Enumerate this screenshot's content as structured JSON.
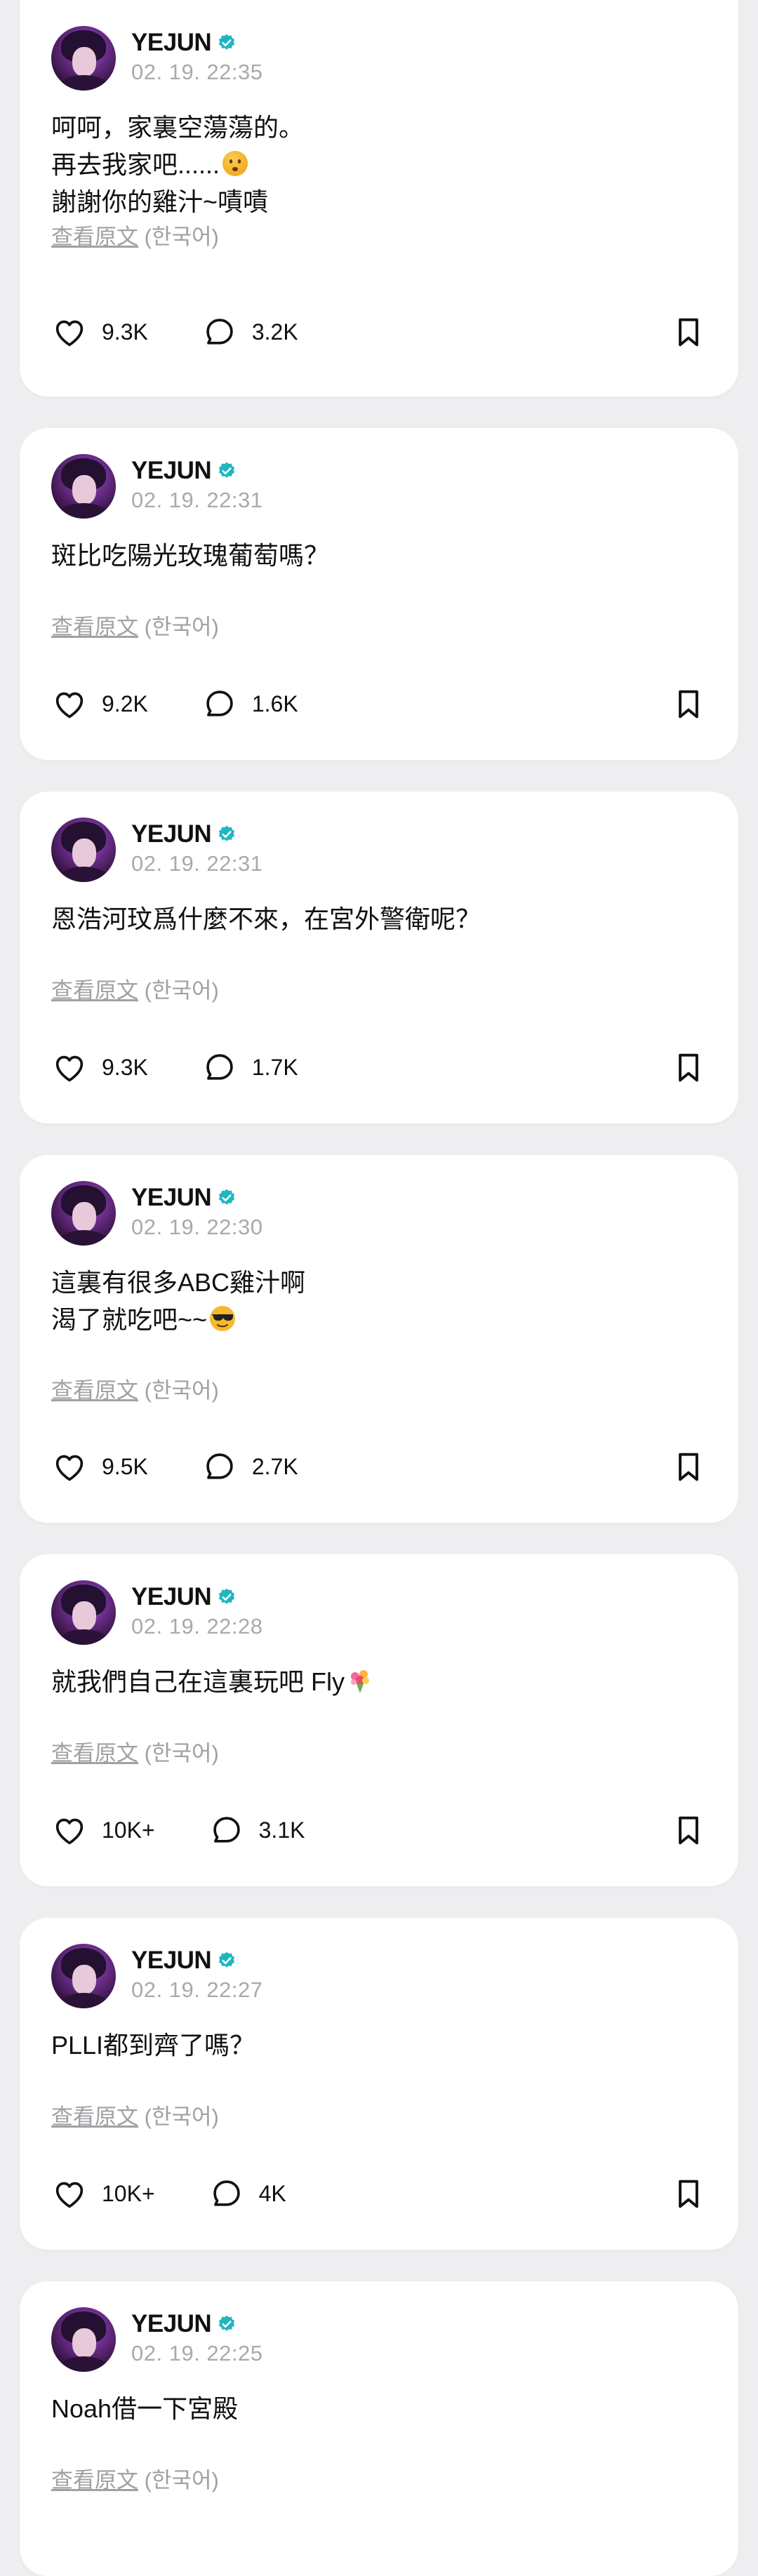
{
  "translate": {
    "link_label": "查看原文",
    "lang_label": "(한국어)"
  },
  "colors": {
    "verified_badge": "#1fb6c1",
    "timestamp": "#a9a9ae",
    "background": "#eeeef0"
  },
  "icons": {
    "like": "heart-icon",
    "comment": "comment-bubble-icon",
    "save": "bookmark-icon",
    "verified": "verified-badge-icon"
  },
  "posts": [
    {
      "author": "YEJUN",
      "time": "02. 19. 22:35",
      "lines": [
        "呵呵，家裏空蕩蕩的。",
        "再去我家吧......",
        "謝謝你的雞汁~嘖嘖"
      ],
      "likes": "9.3K",
      "comments": "3.2K"
    },
    {
      "author": "YEJUN",
      "time": "02. 19. 22:31",
      "lines": [
        "斑比吃陽光玫瑰葡萄嗎？"
      ],
      "likes": "9.2K",
      "comments": "1.6K"
    },
    {
      "author": "YEJUN",
      "time": "02. 19. 22:31",
      "lines": [
        "恩浩河玟爲什麼不來，在宮外警衛呢？"
      ],
      "likes": "9.3K",
      "comments": "1.7K"
    },
    {
      "author": "YEJUN",
      "time": "02. 19. 22:30",
      "lines": [
        "這裏有很多ABC雞汁啊",
        "渴了就吃吧~~"
      ],
      "likes": "9.5K",
      "comments": "2.7K"
    },
    {
      "author": "YEJUN",
      "time": "02. 19. 22:28",
      "lines": [
        "就我們自己在這裏玩吧 Fly"
      ],
      "likes": "10K+",
      "comments": "3.1K"
    },
    {
      "author": "YEJUN",
      "time": "02. 19. 22:27",
      "lines": [
        "PLLI都到齊了嗎？"
      ],
      "likes": "10K+",
      "comments": "4K"
    },
    {
      "author": "YEJUN",
      "time": "02. 19. 22:25",
      "lines": [
        "Noah借一下宮殿"
      ]
    }
  ]
}
